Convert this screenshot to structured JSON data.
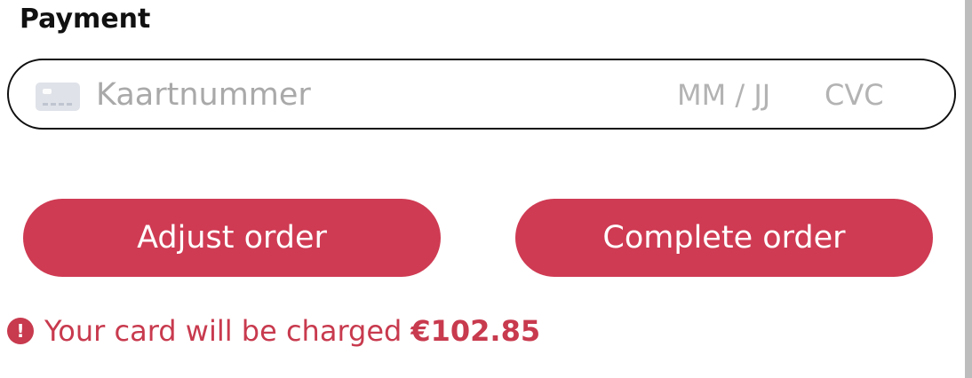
{
  "payment": {
    "title": "Payment",
    "card_number_placeholder": "Kaartnummer",
    "expiry_placeholder": "MM / JJ",
    "cvc_placeholder": "CVC",
    "card_icon": "credit-card-icon"
  },
  "actions": {
    "adjust_label": "Adjust order",
    "complete_label": "Complete order"
  },
  "notice": {
    "icon": "warning-icon",
    "prefix": "Your card will be charged",
    "amount": "€102.85"
  },
  "colors": {
    "accent": "#cf3b53",
    "notice": "#c83a4e",
    "border": "#0f0f0f",
    "placeholder": "#a9a9a9"
  }
}
